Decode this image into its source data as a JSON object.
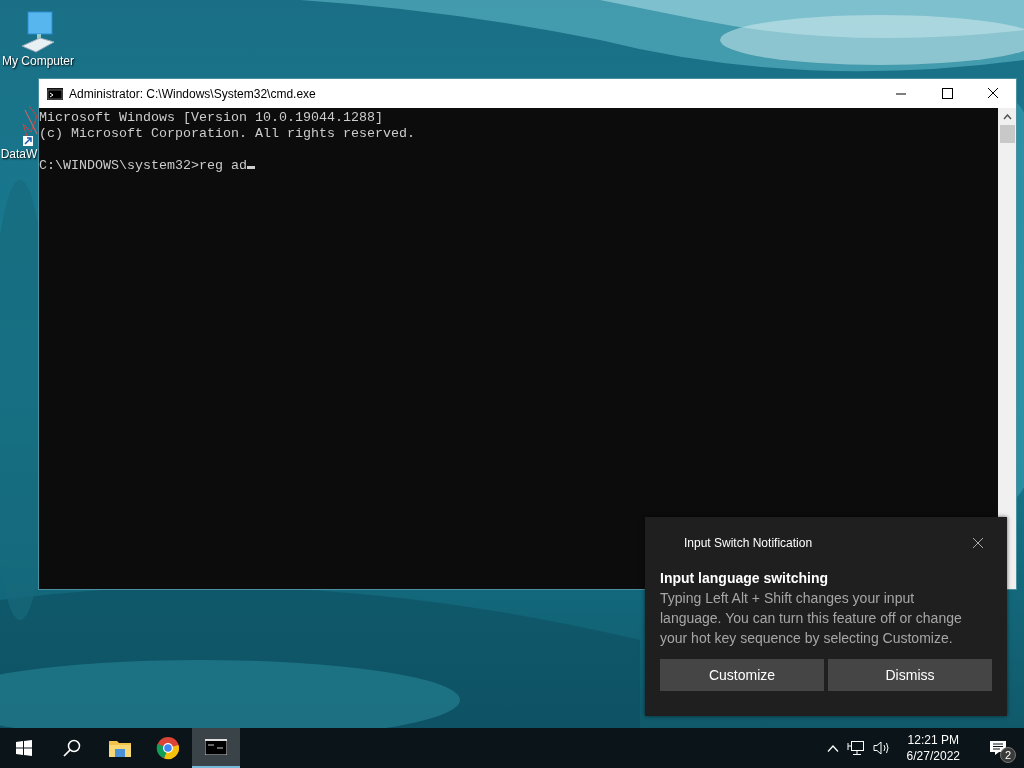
{
  "desktop_icons": [
    {
      "label": "My Computer",
      "kind": "computer"
    },
    {
      "label": "DataW",
      "kind": "shortcut"
    }
  ],
  "window": {
    "title": "Administrator: C:\\Windows\\System32\\cmd.exe",
    "console_lines": [
      "Microsoft Windows [Version 10.0.19044.1288]",
      "(c) Microsoft Corporation. All rights reserved."
    ],
    "prompt": "C:\\WINDOWS\\system32>reg ad"
  },
  "notification": {
    "app": "Input Switch Notification",
    "title": "Input language switching",
    "body": "Typing Left Alt + Shift changes your input language. You can turn this feature off or change your hot key sequence by selecting Customize.",
    "buttons": [
      "Customize",
      "Dismiss"
    ]
  },
  "taskbar": {
    "apps": [
      {
        "kind": "folder",
        "selected": false
      },
      {
        "kind": "browser",
        "selected": false
      },
      {
        "kind": "terminal",
        "selected": true
      }
    ],
    "time": "12:21 PM",
    "date": "6/27/2022",
    "notification_count": "2"
  }
}
